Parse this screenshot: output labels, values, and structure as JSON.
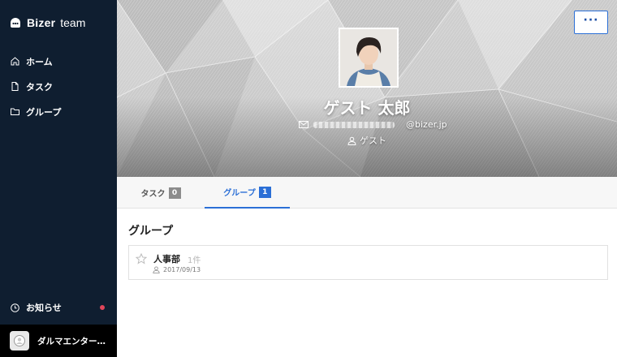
{
  "sidebar": {
    "brand": "Bizer",
    "brand_sub": "team",
    "items": [
      {
        "label": "ホーム",
        "icon": "home-icon"
      },
      {
        "label": "タスク",
        "icon": "document-icon"
      },
      {
        "label": "グループ",
        "icon": "folder-icon"
      }
    ],
    "notice": {
      "label": "お知らせ",
      "icon": "clock-icon",
      "unread": true
    },
    "org": {
      "name": "ダルマエンターテイメント"
    }
  },
  "profile": {
    "name": "ゲスト 太郎",
    "email_domain": "@bizer.jp",
    "role": "ゲスト",
    "more_label": "···"
  },
  "tabs": [
    {
      "label": "タスク",
      "count": "0",
      "active": false
    },
    {
      "label": "グループ",
      "count": "1",
      "active": true
    }
  ],
  "main": {
    "section_title": "グループ",
    "groups": [
      {
        "name": "人事部",
        "count": "1件",
        "date": "2017/09/13"
      }
    ]
  },
  "colors": {
    "sidebar_bg": "#0f1e30",
    "accent": "#2b6fd6",
    "notice_dot": "#e0465a"
  }
}
